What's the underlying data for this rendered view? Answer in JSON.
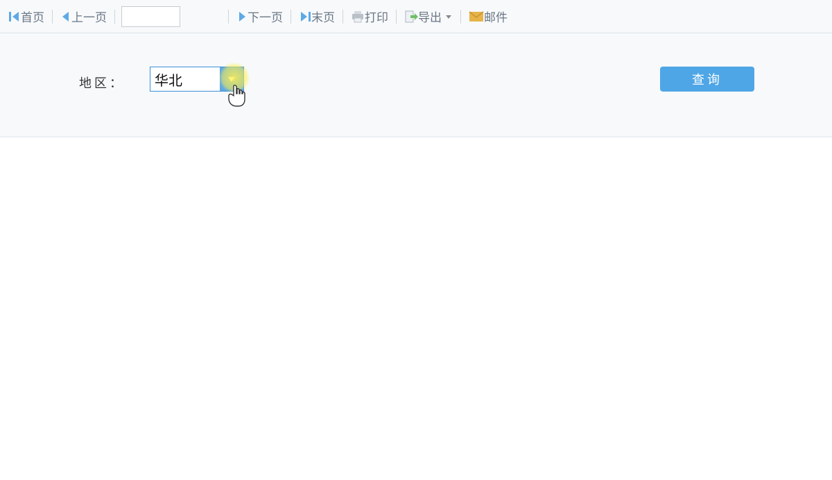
{
  "toolbar": {
    "first": "首页",
    "prev": "上一页",
    "page_value": "",
    "next": "下一页",
    "last": "末页",
    "print": "打印",
    "export": "导出",
    "mail": "邮件"
  },
  "filter": {
    "region_label": "地区：",
    "region_value": "华北",
    "query_label": "查询"
  }
}
